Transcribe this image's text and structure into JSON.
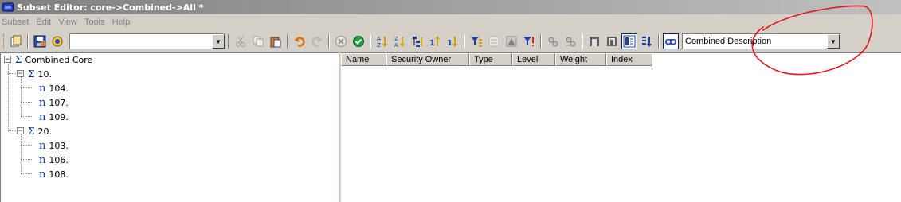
{
  "window": {
    "title": "Subset Editor: core->Combined->All *"
  },
  "menu": [
    "Subset",
    "Edit",
    "View",
    "Tools",
    "Help"
  ],
  "toolbar": {
    "subset_combo_value": "",
    "alias_combo_value": "Combined Description"
  },
  "tree": {
    "root": {
      "label": "Combined Core"
    },
    "groups": [
      {
        "label": "10.",
        "children": [
          "104.",
          "107.",
          "109."
        ]
      },
      {
        "label": "20.",
        "children": [
          "103.",
          "106.",
          "108."
        ]
      }
    ]
  },
  "grid": {
    "columns": [
      "Name",
      "Security Owner",
      "Type",
      "Level",
      "Weight",
      "Index"
    ]
  },
  "colors": {
    "annotation": "#e8141c",
    "sigma": "#003399"
  }
}
